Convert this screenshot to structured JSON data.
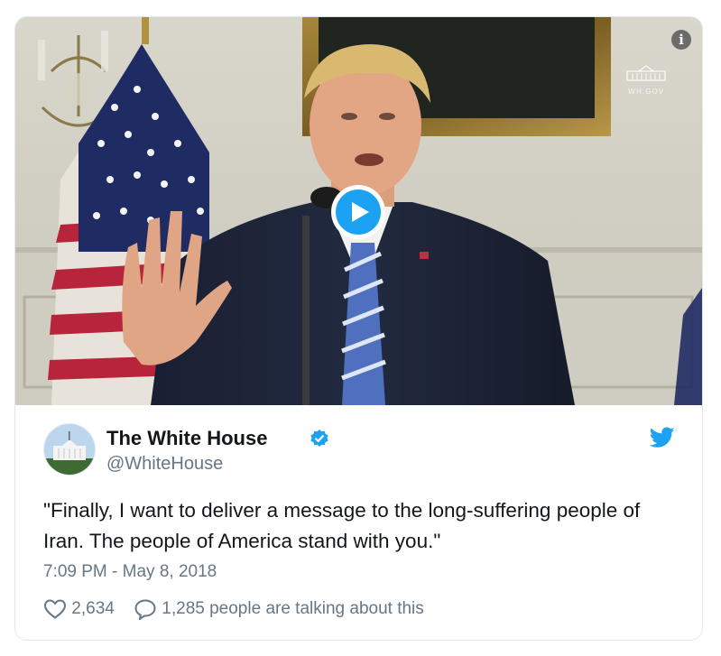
{
  "media": {
    "watermark_text": "WH.GOV",
    "info_icon": "info-icon",
    "play_icon": "play-icon"
  },
  "tweet": {
    "author_name": "The White House",
    "handle": "@WhiteHouse",
    "verified_icon": "verified-badge-icon",
    "platform_icon": "twitter-bird-icon",
    "text": "\"Finally, I want to deliver a message to the long-suffering people of Iran. The people of America stand with you.\"",
    "timestamp": "7:09 PM - May 8, 2018",
    "likes": "2,634",
    "talking": "1,285 people are talking about this"
  },
  "colors": {
    "accent": "#1da1f2",
    "secondary_text": "#657786",
    "primary_text": "#14171a",
    "border": "#e1e8ed"
  }
}
